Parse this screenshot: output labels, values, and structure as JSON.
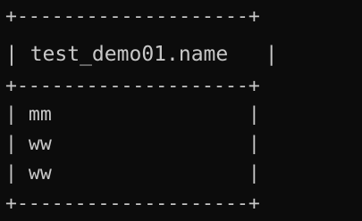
{
  "terminal": {
    "border_top": "+--------------------+",
    "header": "| test_demo01.name   |",
    "border_mid": "+--------------------+",
    "rows": [
      "| mm                 |",
      "| ww                 |",
      "| ww                 |"
    ],
    "border_bottom": "+--------------------+"
  }
}
